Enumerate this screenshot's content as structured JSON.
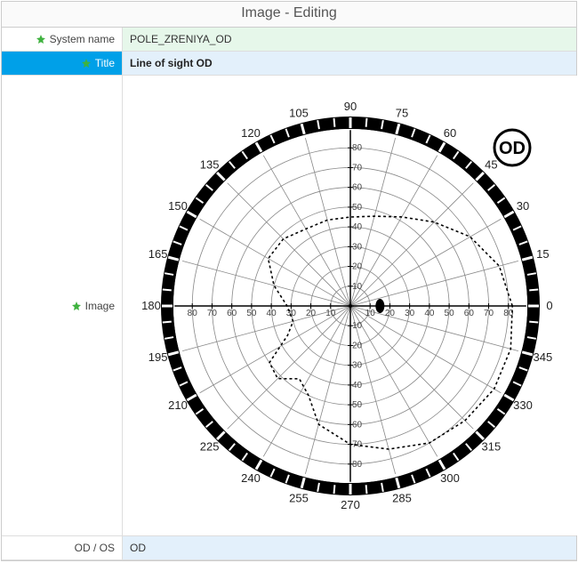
{
  "header": {
    "title": "Image - Editing"
  },
  "fields": {
    "system_name_label": "System name",
    "system_name_value": "POLE_ZRENIYA_OD",
    "title_label": "Title",
    "title_value": "Line of sight OD",
    "image_label": "Image",
    "odos_label": "OD / OS",
    "odos_value": "OD"
  },
  "chart_data": {
    "type": "polar",
    "badge": "OD",
    "rings": [
      10,
      20,
      30,
      40,
      50,
      60,
      70,
      80
    ],
    "outer_radius": 90,
    "angle_labels": [
      0,
      15,
      30,
      45,
      60,
      75,
      90,
      105,
      120,
      135,
      150,
      165,
      180,
      195,
      210,
      225,
      240,
      255,
      270,
      285,
      300,
      315,
      330,
      345
    ],
    "axis_tick_labels_h": [
      -80,
      -70,
      -60,
      -50,
      -40,
      -30,
      -20,
      -10,
      10,
      20,
      30,
      40,
      50,
      60,
      70,
      80
    ],
    "axis_tick_labels_v": [
      -80,
      -70,
      -60,
      -50,
      -40,
      -30,
      -20,
      -10,
      10,
      20,
      30,
      40,
      50,
      60,
      70,
      80
    ],
    "blind_spot": {
      "angle_deg": 0,
      "radius_val": 15,
      "rx": 5,
      "ry": 8
    },
    "isopter": [
      {
        "a": 0,
        "r": 82
      },
      {
        "a": 15,
        "r": 78
      },
      {
        "a": 30,
        "r": 70
      },
      {
        "a": 45,
        "r": 60
      },
      {
        "a": 60,
        "r": 52
      },
      {
        "a": 75,
        "r": 47
      },
      {
        "a": 90,
        "r": 45
      },
      {
        "a": 105,
        "r": 45
      },
      {
        "a": 120,
        "r": 45
      },
      {
        "a": 135,
        "r": 48
      },
      {
        "a": 150,
        "r": 48
      },
      {
        "a": 165,
        "r": 40
      },
      {
        "a": 180,
        "r": 32
      },
      {
        "a": 195,
        "r": 30
      },
      {
        "a": 205,
        "r": 35
      },
      {
        "a": 215,
        "r": 50
      },
      {
        "a": 225,
        "r": 52
      },
      {
        "a": 235,
        "r": 45
      },
      {
        "a": 245,
        "r": 50
      },
      {
        "a": 255,
        "r": 62
      },
      {
        "a": 270,
        "r": 70
      },
      {
        "a": 285,
        "r": 75
      },
      {
        "a": 300,
        "r": 80
      },
      {
        "a": 315,
        "r": 82
      },
      {
        "a": 330,
        "r": 84
      },
      {
        "a": 345,
        "r": 84
      }
    ]
  }
}
